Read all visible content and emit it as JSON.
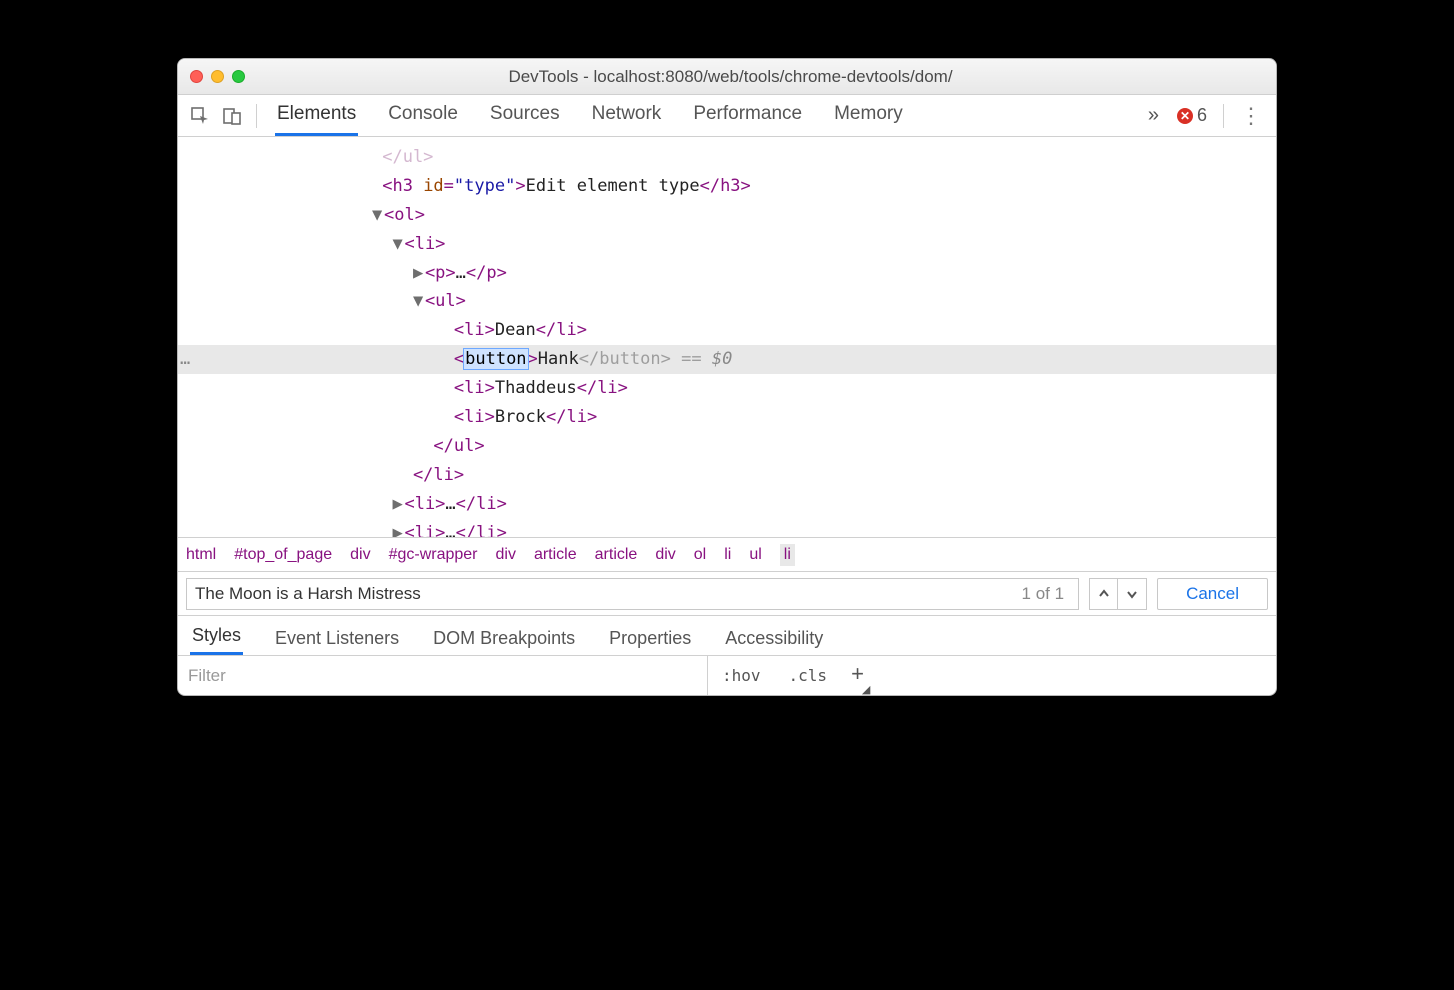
{
  "window": {
    "title": "DevTools - localhost:8080/web/tools/chrome-devtools/dom/"
  },
  "toolbar": {
    "tabs": [
      "Elements",
      "Console",
      "Sources",
      "Network",
      "Performance",
      "Memory"
    ],
    "active_tab": "Elements",
    "overflow": "»",
    "error_count": "6"
  },
  "dom": {
    "line_cutoff_close": "</ul>",
    "h3_open": "<h3 ",
    "h3_attr": "id",
    "h3_val": "\"type\"",
    "h3_text": "Edit element type",
    "h3_close": "</h3>",
    "ol_open": "<ol>",
    "li_open": "<li>",
    "p_open": "<p>",
    "p_ell": "…",
    "p_close": "</p>",
    "ul_open": "<ul>",
    "li1_open": "<li>",
    "li1_text": "Dean",
    "li1_close": "</li>",
    "sel_open": "<",
    "sel_tag_edit": "button",
    "sel_mid": ">",
    "sel_text": "Hank",
    "sel_close_ghost": "</button>",
    "sel_eq": " == ",
    "sel_var": "$0",
    "li3_open": "<li>",
    "li3_text": "Thaddeus",
    "li3_close": "</li>",
    "li4_open": "<li>",
    "li4_text": "Brock",
    "li4_close": "</li>",
    "ul_close": "</ul>",
    "li_close": "</li>",
    "lix_open": "<li>",
    "lix_ell": "…",
    "lix_close": "</li>"
  },
  "breadcrumb": [
    "html",
    "#top_of_page",
    "div",
    "#gc-wrapper",
    "div",
    "article",
    "article",
    "div",
    "ol",
    "li",
    "ul",
    "li"
  ],
  "search": {
    "query": "The Moon is a Harsh Mistress",
    "count": "1 of 1",
    "cancel": "Cancel"
  },
  "subtabs": [
    "Styles",
    "Event Listeners",
    "DOM Breakpoints",
    "Properties",
    "Accessibility"
  ],
  "subtabs_active": "Styles",
  "filter": {
    "placeholder": "Filter",
    "hov": ":hov",
    "cls": ".cls"
  }
}
